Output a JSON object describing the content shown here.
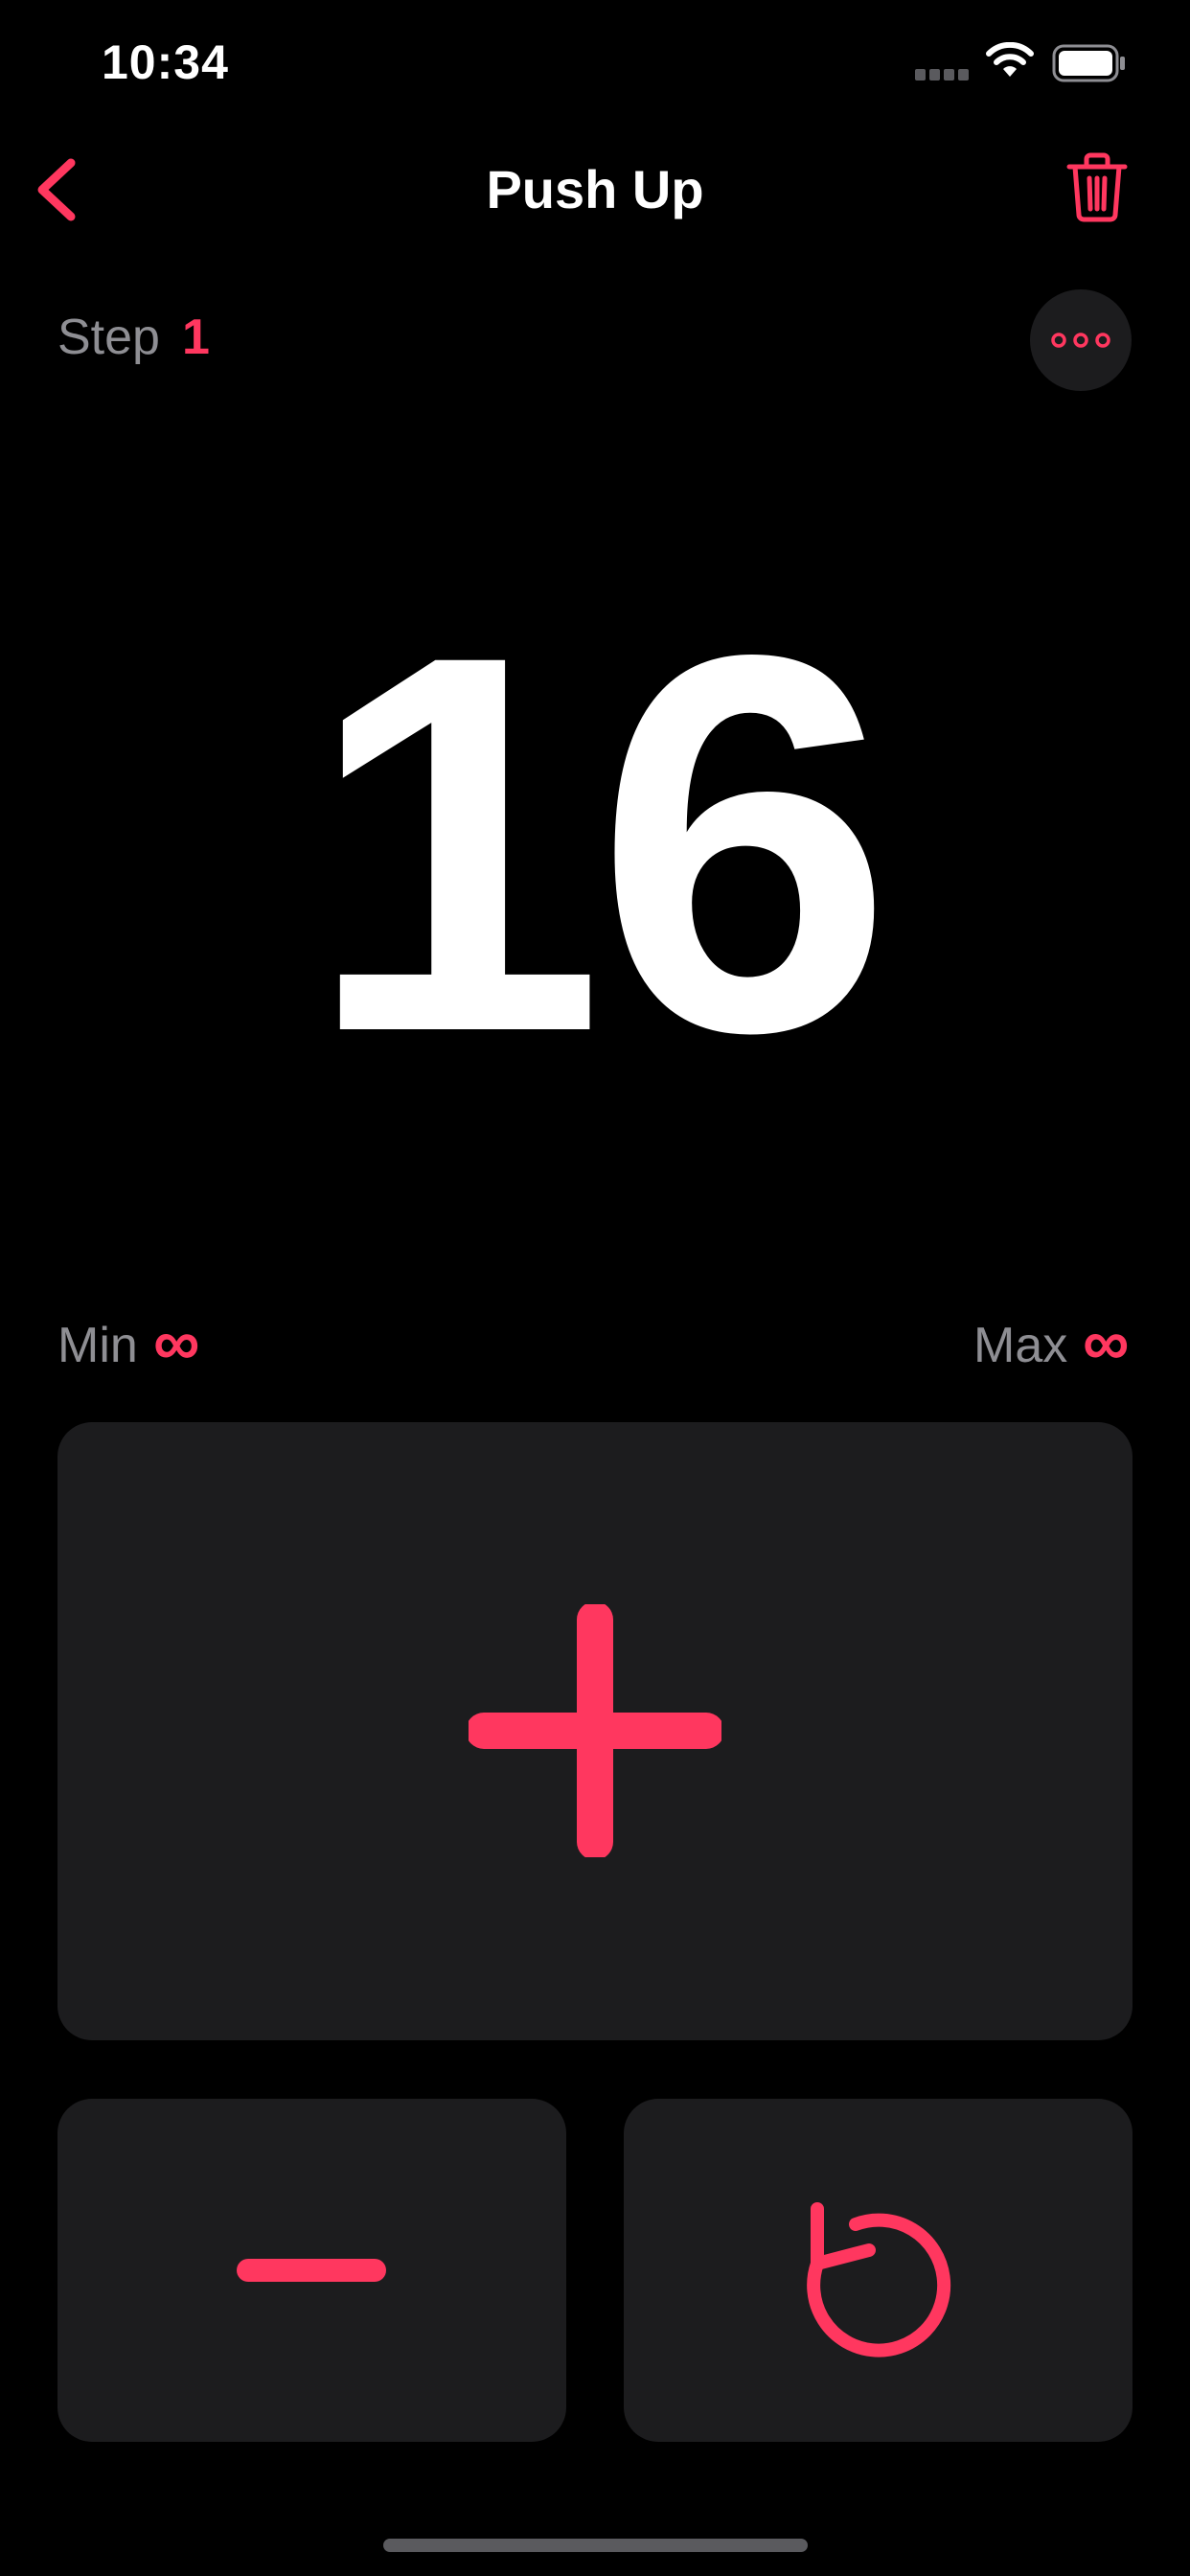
{
  "status_bar": {
    "time": "10:34"
  },
  "nav": {
    "title": "Push Up",
    "back_icon": "chevron-left-icon",
    "trash_icon": "trash-icon"
  },
  "step": {
    "label": "Step",
    "value": "1",
    "more_icon": "ellipsis-icon"
  },
  "counter": {
    "value": "16"
  },
  "limits": {
    "min_label": "Min",
    "min_value": "∞",
    "max_label": "Max",
    "max_value": "∞"
  },
  "controls": {
    "increment_icon": "plus-icon",
    "decrement_icon": "minus-icon",
    "reset_icon": "reset-icon"
  },
  "colors": {
    "accent": "#ff375f",
    "background": "#000000",
    "surface": "#1c1c1e",
    "secondary_text": "#8e8e93"
  }
}
